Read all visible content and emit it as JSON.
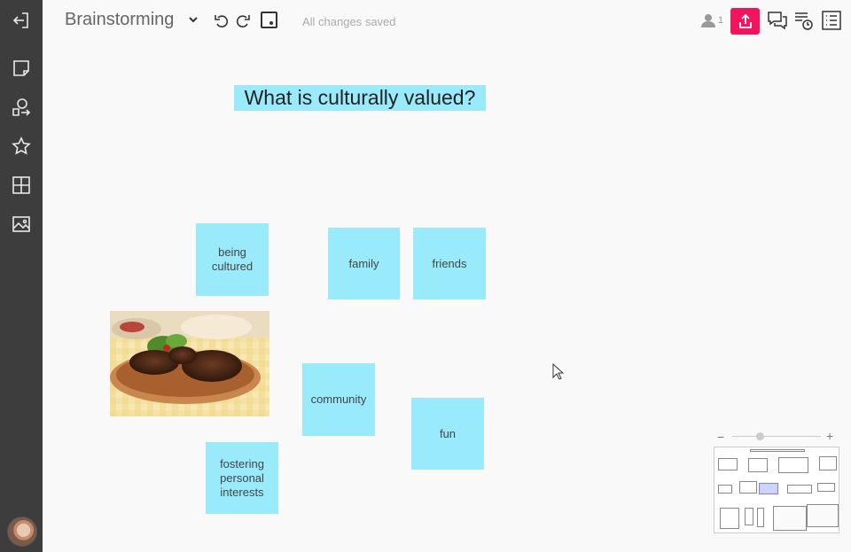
{
  "header": {
    "board_title": "Brainstorming",
    "save_status": "All changes saved",
    "collaborator_count": "1"
  },
  "canvas": {
    "heading": "What is culturally valued?",
    "notes": [
      {
        "text": "being cultured"
      },
      {
        "text": "family"
      },
      {
        "text": "friends"
      },
      {
        "text": "community"
      },
      {
        "text": "fun"
      },
      {
        "text": "fostering personal interests"
      }
    ]
  },
  "icons": {
    "sidebar": [
      "exit-board-icon",
      "sticky-note-icon",
      "shapes-icon",
      "star-icon",
      "grid-icon",
      "image-icon"
    ],
    "topbar": [
      "chevron-down-icon",
      "undo-icon",
      "redo-icon",
      "frame-icon",
      "user-icon",
      "share-icon",
      "comments-icon",
      "history-icon",
      "outline-list-icon"
    ]
  },
  "colors": {
    "sticky_note": "#99ebfb",
    "share_button": "#f2145f",
    "sidebar_bg": "#3d3d3d"
  }
}
